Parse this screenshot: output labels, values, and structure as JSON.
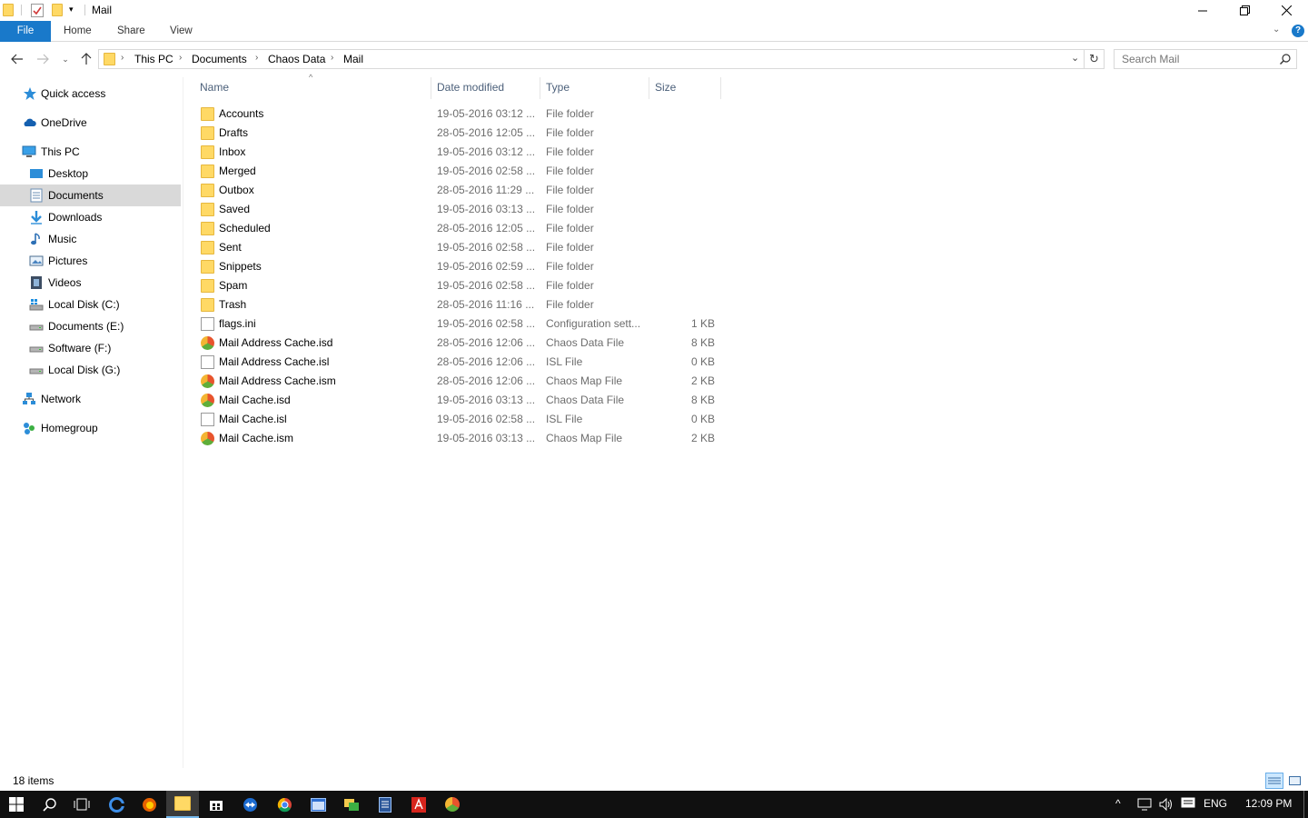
{
  "window": {
    "title": "Mail"
  },
  "ribbon": {
    "tabs": [
      "File",
      "Home",
      "Share",
      "View"
    ]
  },
  "address": {
    "crumbs": [
      "This PC",
      "Documents",
      "Chaos Data",
      "Mail"
    ]
  },
  "search": {
    "placeholder": "Search Mail"
  },
  "navpane": {
    "items": [
      {
        "label": "Quick access",
        "icon": "star-icon"
      },
      {
        "label": "OneDrive",
        "icon": "cloud-icon"
      },
      {
        "label": "This PC",
        "icon": "computer-icon"
      },
      {
        "label": "Desktop",
        "icon": "desktop-icon"
      },
      {
        "label": "Documents",
        "icon": "documents-icon",
        "selected": true
      },
      {
        "label": "Downloads",
        "icon": "download-arrow-icon"
      },
      {
        "label": "Music",
        "icon": "music-note-icon"
      },
      {
        "label": "Pictures",
        "icon": "pictures-icon"
      },
      {
        "label": "Videos",
        "icon": "film-icon"
      },
      {
        "label": "Local Disk (C:)",
        "icon": "windows-drive-icon"
      },
      {
        "label": "Documents (E:)",
        "icon": "drive-icon"
      },
      {
        "label": "Software (F:)",
        "icon": "drive-icon"
      },
      {
        "label": "Local Disk (G:)",
        "icon": "drive-icon"
      },
      {
        "label": "Network",
        "icon": "network-icon"
      },
      {
        "label": "Homegroup",
        "icon": "homegroup-icon"
      }
    ]
  },
  "columns": {
    "name": "Name",
    "date": "Date modified",
    "type": "Type",
    "size": "Size"
  },
  "files": [
    {
      "name": "Accounts",
      "date": "19-05-2016 03:12 ...",
      "type": "File folder",
      "size": "",
      "icon": "folder-icon"
    },
    {
      "name": "Drafts",
      "date": "28-05-2016 12:05 ...",
      "type": "File folder",
      "size": "",
      "icon": "folder-icon"
    },
    {
      "name": "Inbox",
      "date": "19-05-2016 03:12 ...",
      "type": "File folder",
      "size": "",
      "icon": "folder-icon"
    },
    {
      "name": "Merged",
      "date": "19-05-2016 02:58 ...",
      "type": "File folder",
      "size": "",
      "icon": "folder-icon"
    },
    {
      "name": "Outbox",
      "date": "28-05-2016 11:29 ...",
      "type": "File folder",
      "size": "",
      "icon": "folder-icon"
    },
    {
      "name": "Saved",
      "date": "19-05-2016 03:13 ...",
      "type": "File folder",
      "size": "",
      "icon": "folder-icon"
    },
    {
      "name": "Scheduled",
      "date": "28-05-2016 12:05 ...",
      "type": "File folder",
      "size": "",
      "icon": "folder-icon"
    },
    {
      "name": "Sent",
      "date": "19-05-2016 02:58 ...",
      "type": "File folder",
      "size": "",
      "icon": "folder-icon"
    },
    {
      "name": "Snippets",
      "date": "19-05-2016 02:59 ...",
      "type": "File folder",
      "size": "",
      "icon": "folder-icon"
    },
    {
      "name": "Spam",
      "date": "19-05-2016 02:58 ...",
      "type": "File folder",
      "size": "",
      "icon": "folder-icon"
    },
    {
      "name": "Trash",
      "date": "28-05-2016 11:16 ...",
      "type": "File folder",
      "size": "",
      "icon": "folder-icon"
    },
    {
      "name": "flags.ini",
      "date": "19-05-2016 02:58 ...",
      "type": "Configuration sett...",
      "size": "1 KB",
      "icon": "config-file-icon"
    },
    {
      "name": "Mail Address Cache.isd",
      "date": "28-05-2016 12:06 ...",
      "type": "Chaos Data File",
      "size": "8 KB",
      "icon": "chaos-file-icon"
    },
    {
      "name": "Mail Address Cache.isl",
      "date": "28-05-2016 12:06 ...",
      "type": "ISL File",
      "size": "0 KB",
      "icon": "blank-file-icon"
    },
    {
      "name": "Mail Address Cache.ism",
      "date": "28-05-2016 12:06 ...",
      "type": "Chaos Map File",
      "size": "2 KB",
      "icon": "chaos-file-icon"
    },
    {
      "name": "Mail Cache.isd",
      "date": "19-05-2016 03:13 ...",
      "type": "Chaos Data File",
      "size": "8 KB",
      "icon": "chaos-file-icon"
    },
    {
      "name": "Mail Cache.isl",
      "date": "19-05-2016 02:58 ...",
      "type": "ISL File",
      "size": "0 KB",
      "icon": "blank-file-icon"
    },
    {
      "name": "Mail Cache.ism",
      "date": "19-05-2016 03:13 ...",
      "type": "Chaos Map File",
      "size": "2 KB",
      "icon": "chaos-file-icon"
    }
  ],
  "status": {
    "count": "18 items"
  },
  "taskbar": {
    "language": "ENG",
    "time": "12:09 PM",
    "apps": [
      "start-icon",
      "search-icon",
      "task-view-icon",
      "edge-icon",
      "firefox-icon",
      "file-explorer-icon",
      "store-icon",
      "teamviewer-icon",
      "chrome-icon",
      "window-app-icon",
      "mail-app-icon",
      "document-app-icon",
      "acrobat-icon",
      "chaos-app-icon"
    ]
  },
  "colors": {
    "accent": "#1979ca",
    "selection": "#d9d9d9",
    "taskbar": "#101010"
  }
}
